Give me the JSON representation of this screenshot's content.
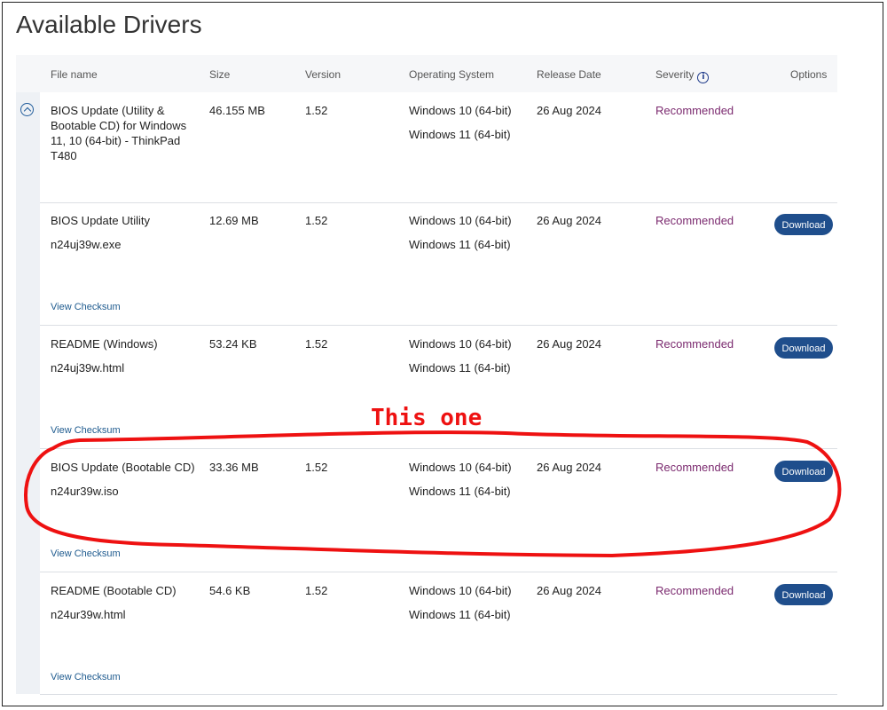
{
  "page": {
    "title": "Available Drivers"
  },
  "table": {
    "headers": {
      "file_name": "File name",
      "size": "Size",
      "version": "Version",
      "os": "Operating System",
      "release_date": "Release Date",
      "severity": "Severity",
      "options": "Options"
    },
    "rows": [
      {
        "title": "BIOS Update (Utility & Bootable CD) for Windows 11, 10 (64-bit) - ThinkPad T480",
        "file": "",
        "size": "46.155 MB",
        "version": "1.52",
        "os": [
          "Windows 10 (64-bit)",
          "Windows 11 (64-bit)"
        ],
        "release_date": "26 Aug 2024",
        "severity": "Recommended",
        "download": "",
        "checksum": ""
      },
      {
        "title": "BIOS Update Utility",
        "file": "n24uj39w.exe",
        "size": "12.69 MB",
        "version": "1.52",
        "os": [
          "Windows 10 (64-bit)",
          "Windows 11 (64-bit)"
        ],
        "release_date": "26 Aug 2024",
        "severity": "Recommended",
        "download": "Download",
        "checksum": "View Checksum"
      },
      {
        "title": "README (Windows)",
        "file": "n24uj39w.html",
        "size": "53.24 KB",
        "version": "1.52",
        "os": [
          "Windows 10 (64-bit)",
          "Windows 11 (64-bit)"
        ],
        "release_date": "26 Aug 2024",
        "severity": "Recommended",
        "download": "Download",
        "checksum": "View Checksum"
      },
      {
        "title": "BIOS Update (Bootable CD)",
        "file": "n24ur39w.iso",
        "size": "33.36 MB",
        "version": "1.52",
        "os": [
          "Windows 10 (64-bit)",
          "Windows 11 (64-bit)"
        ],
        "release_date": "26 Aug 2024",
        "severity": "Recommended",
        "download": "Download",
        "checksum": "View Checksum"
      },
      {
        "title": "README (Bootable CD)",
        "file": "n24ur39w.html",
        "size": "54.6 KB",
        "version": "1.52",
        "os": [
          "Windows 10 (64-bit)",
          "Windows 11 (64-bit)"
        ],
        "release_date": "26 Aug 2024",
        "severity": "Recommended",
        "download": "Download",
        "checksum": "View Checksum"
      }
    ]
  },
  "annotation": {
    "text": "This one",
    "color": "#ee1111"
  },
  "colors": {
    "severity": "#7b2a6f",
    "download_button": "#1f4e8c",
    "link": "#1f5b8f"
  },
  "icons": {
    "collapse": "chevron-up-circle-icon",
    "info": "info-circle-icon"
  }
}
